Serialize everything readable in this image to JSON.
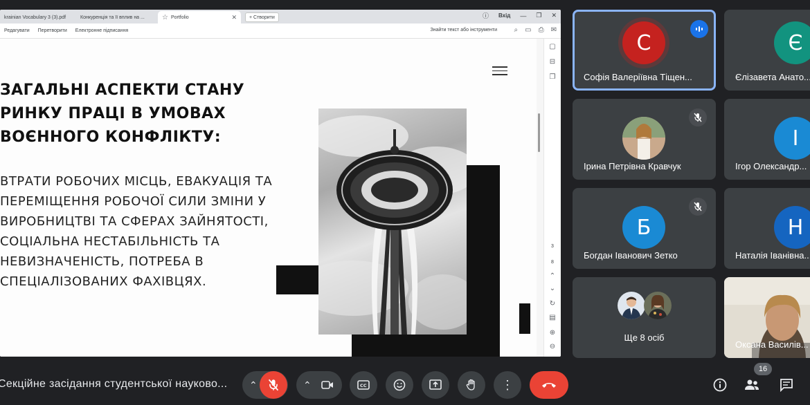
{
  "browser": {
    "tabs": [
      {
        "label": "krainian Vocabulary 3 (3).pdf",
        "active": false
      },
      {
        "label": "Конкуренція та її вплив на ...",
        "active": false
      },
      {
        "label": "Portfolio",
        "active": true
      }
    ],
    "new_tab_label": "+ Створити",
    "login_label": "Вхід"
  },
  "pdf_toolbar": {
    "menu": [
      "Редагувати",
      "Перетворити",
      "Електронне підписання"
    ],
    "find_label": "Знайти текст або інструменти"
  },
  "slide": {
    "title": "ЗАГАЛЬНІ АСПЕКТИ СТАНУ РИНКУ ПРАЦІ В УМОВАХ ВОЄННОГО КОНФЛІКТУ:",
    "body": "ВТРАТИ РОБОЧИХ МІСЦЬ, ЕВАКУАЦІЯ ТА ПЕРЕМІЩЕННЯ РОБОЧОЇ СИЛИ ЗМІНИ У ВИРОБНИЦТВІ ТА СФЕРАХ ЗАЙНЯТОСТІ, СОЦІАЛЬНА НЕСТАБІЛЬНІСТЬ ТА НЕВИЗНАЧЕНІСТЬ, ПОТРЕБА В СПЕЦІАЛІЗОВАНИХ ФАХІВЦЯХ."
  },
  "pager": {
    "current": "3",
    "total": "8"
  },
  "participants": [
    {
      "name": "Софія Валеріївна Тіщен...",
      "initial": "С",
      "color": "#c5221f",
      "speaking": true
    },
    {
      "name": "Єлізавета Анато...",
      "initial": "Є",
      "color": "#12937f"
    },
    {
      "name": "Ірина Петрівна Кравчук",
      "muted": true
    },
    {
      "name": "Ігор Олександр...",
      "initial": "І",
      "color": "#1a8ad4"
    },
    {
      "name": "Богдан Іванович Зетко",
      "initial": "Б",
      "color": "#1a8ad4",
      "muted": true
    },
    {
      "name": "Наталія Іванівна...",
      "initial": "Н",
      "color": "#1565c0"
    },
    {
      "name": "Ще 8 осіб"
    },
    {
      "name": "Оксана Василів..."
    }
  ],
  "meeting_title": "Секційне засідання студентської науково...",
  "participant_count": "16",
  "colors": {
    "accent": "#8ab4f8",
    "danger": "#ea4335",
    "tile_bg": "#3c4043",
    "bg": "#202124"
  }
}
